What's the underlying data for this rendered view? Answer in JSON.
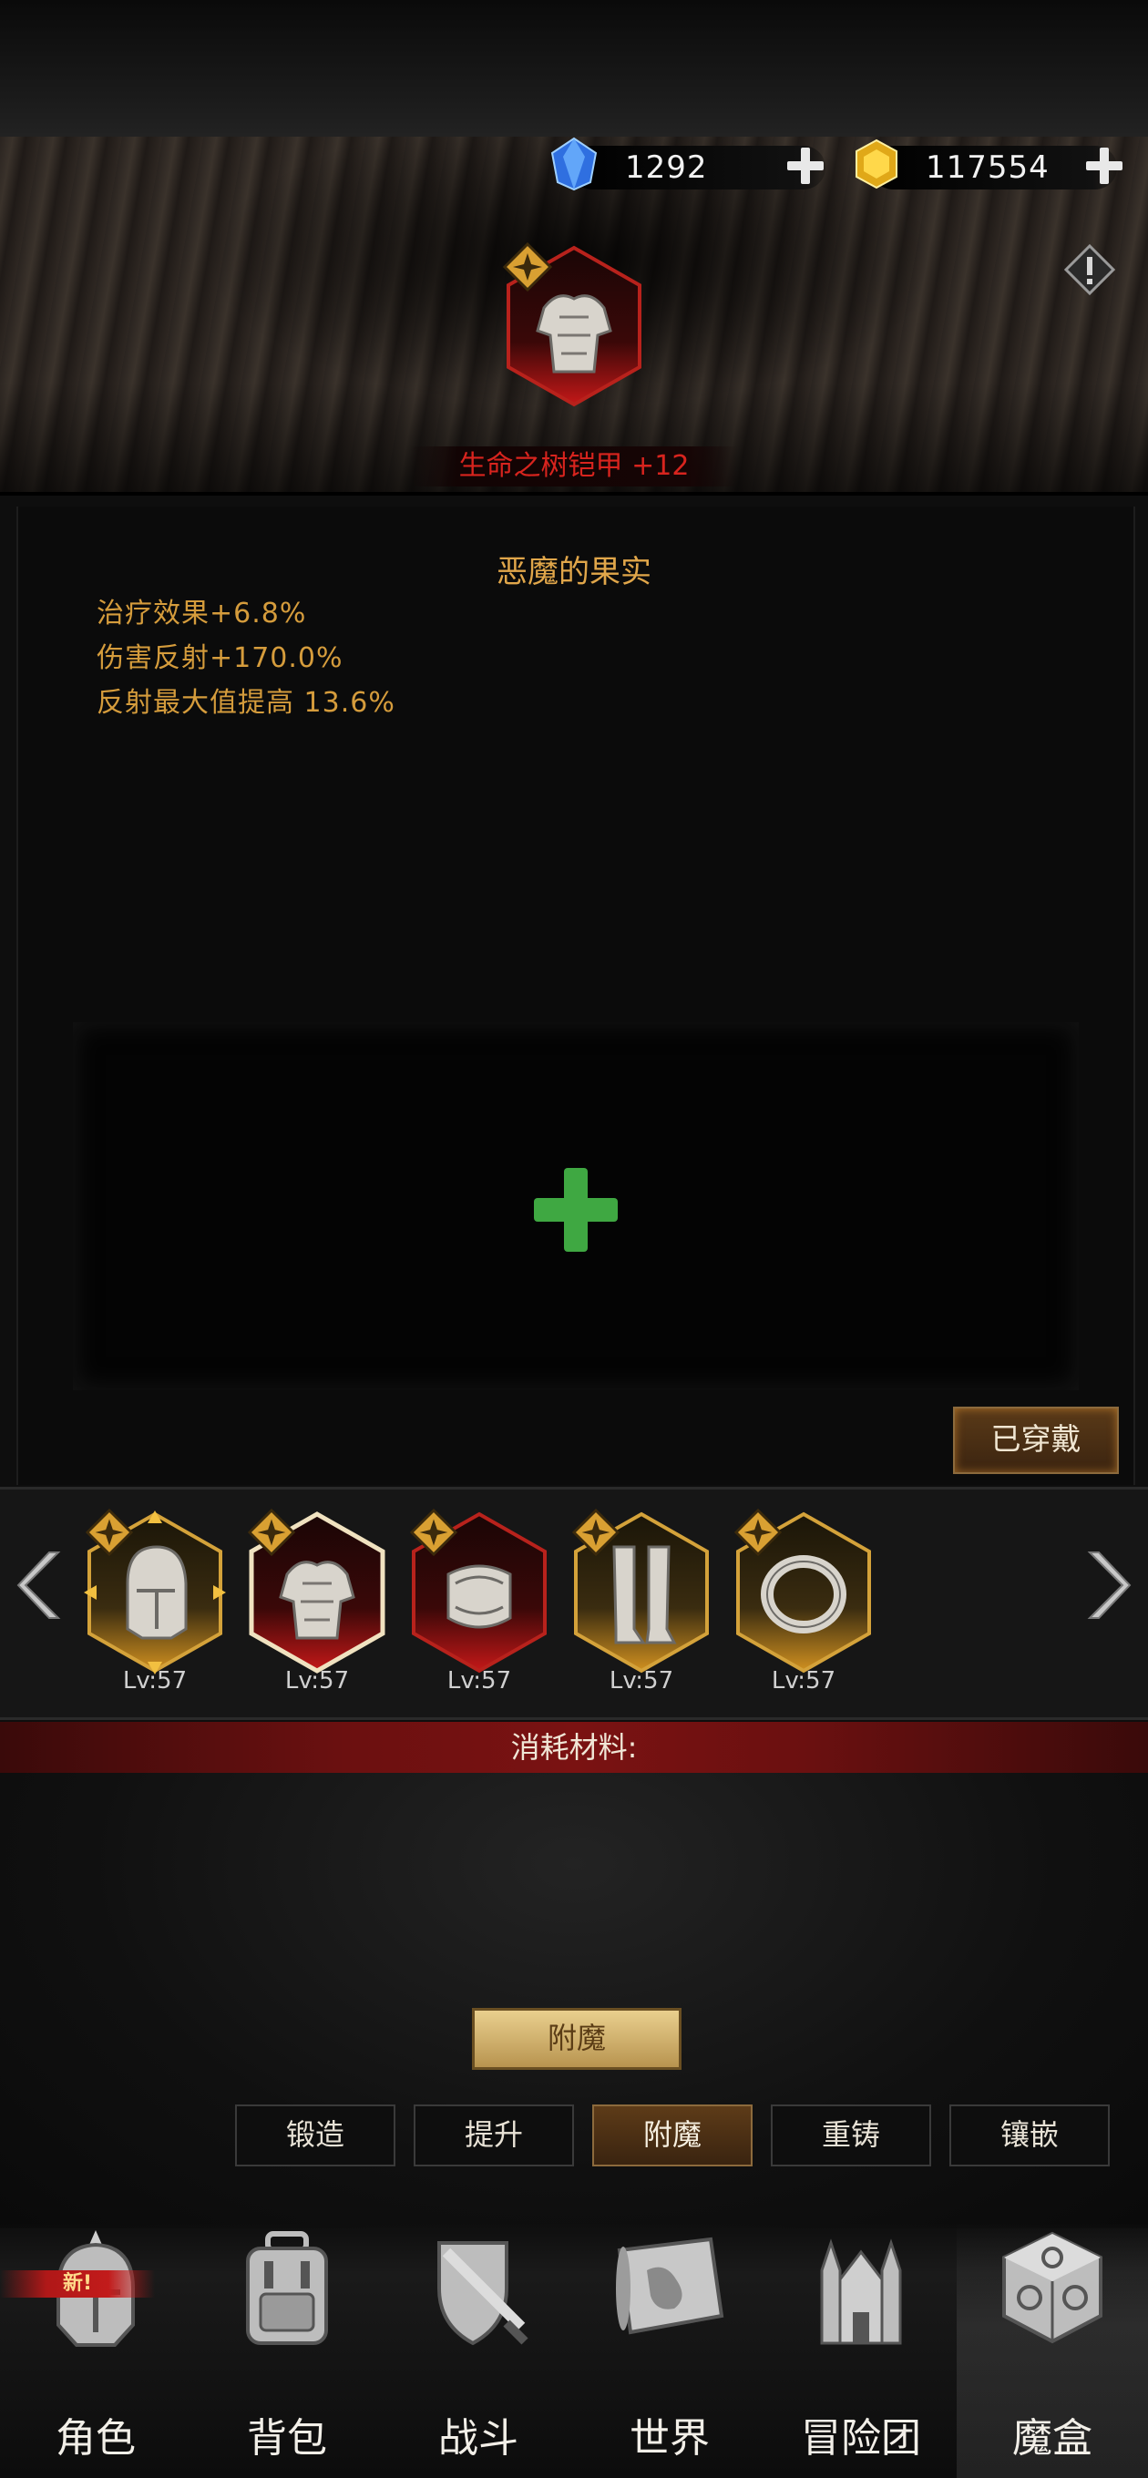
{
  "currency": {
    "diamonds": "1292",
    "gold": "117554"
  },
  "item": {
    "name": "生命之树铠甲 +12"
  },
  "enchant_info": {
    "title": "恶魔的果实",
    "stats": [
      "治疗效果+6.8%",
      "伤害反射+170.0%",
      "反射最大值提高 13.6%"
    ]
  },
  "equipped_label": "已穿戴",
  "equipment": [
    {
      "name": "helmet",
      "level": "Lv:57"
    },
    {
      "name": "armor",
      "level": "Lv:57"
    },
    {
      "name": "bracer",
      "level": "Lv:57"
    },
    {
      "name": "greaves",
      "level": "Lv:57"
    },
    {
      "name": "ring",
      "level": "Lv:57"
    }
  ],
  "materials_label": "消耗材料:",
  "enchant_button": "附魔",
  "subtabs": [
    "锻造",
    "提升",
    "附魔",
    "重铸",
    "镶嵌"
  ],
  "active_subtab": "附魔",
  "nav": [
    {
      "label": "角色",
      "icon": "character-helmet-icon"
    },
    {
      "label": "背包",
      "icon": "backpack-icon"
    },
    {
      "label": "战斗",
      "icon": "battle-sword-shield-icon"
    },
    {
      "label": "世界",
      "icon": "world-map-icon"
    },
    {
      "label": "冒险团",
      "icon": "castle-icon"
    },
    {
      "label": "魔盒",
      "icon": "magic-box-icon"
    }
  ],
  "nav_badge": "新!",
  "colors": {
    "accent_gold": "#d59c3c",
    "item_name_red": "#d8241e",
    "add_green": "#3fa842"
  }
}
